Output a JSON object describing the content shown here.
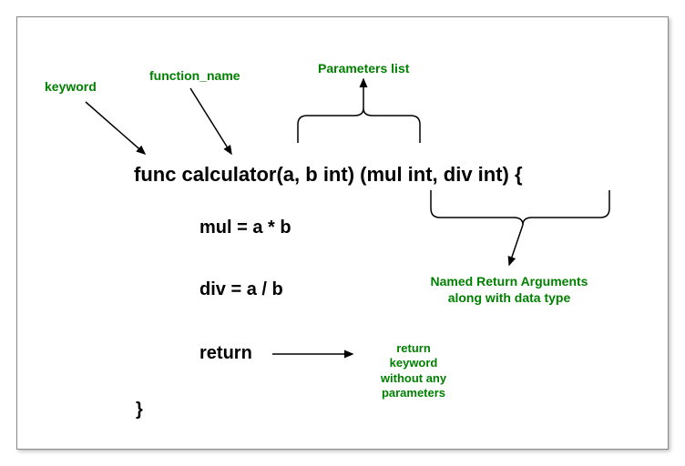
{
  "labels": {
    "keyword": "keyword",
    "function_name": "function_name",
    "parameters_list": "Parameters list",
    "named_return": "Named Return Arguments\nalong with data type",
    "return_note": "return\nkeyword\nwithout any\nparameters"
  },
  "code": {
    "signature": "func calculator(a, b int) (mul int, div int) {",
    "line1": "mul = a * b",
    "line2": "div = a / b",
    "line3": "return",
    "close": "}"
  }
}
